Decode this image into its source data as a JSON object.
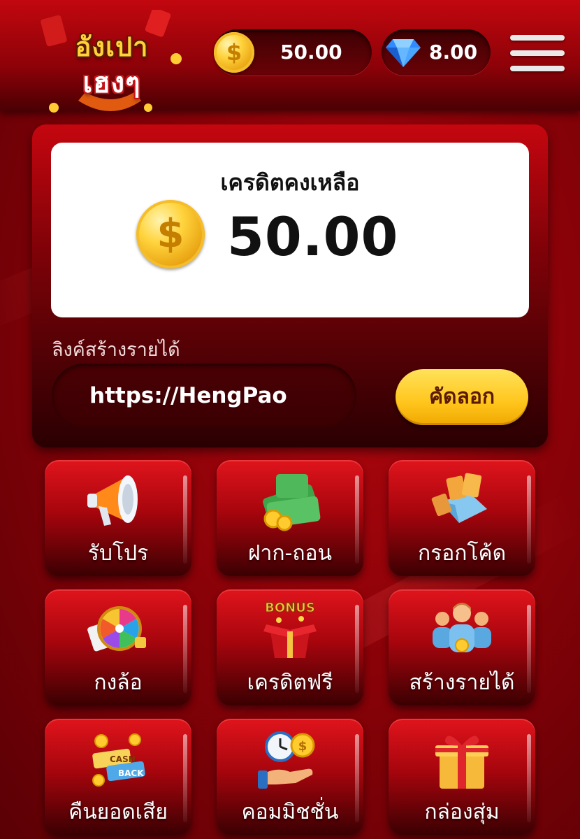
{
  "header": {
    "logo_line1": "อังเปา",
    "logo_line2": "เฮงๆ",
    "coin_balance": "50.00",
    "gem_balance": "8.00",
    "coin_symbol": "$"
  },
  "balance_panel": {
    "title": "เครดิตคงเหลือ",
    "amount": "50.00",
    "coin_symbol": "$",
    "link_label": "ลิงค์สร้างรายได้",
    "link_value": "https://HengPao",
    "copy_label": "คัดลอก"
  },
  "menu_tiles": [
    {
      "label": "รับโปร",
      "icon": "megaphone-icon"
    },
    {
      "label": "ฝาก-ถอน",
      "icon": "money-stack-icon"
    },
    {
      "label": "กรอกโค้ด",
      "icon": "coupon-envelope-icon"
    },
    {
      "label": "กงล้อ",
      "icon": "prize-wheel-icon"
    },
    {
      "label": "เครดิตฟรี",
      "icon": "bonus-box-icon"
    },
    {
      "label": "สร้างรายได้",
      "icon": "team-users-icon"
    },
    {
      "label": "คืนยอดเสีย",
      "icon": "cashback-icon"
    },
    {
      "label": "คอมมิชชั่น",
      "icon": "commission-hand-icon"
    },
    {
      "label": "กล่องสุ่ม",
      "icon": "gift-box-icon"
    }
  ],
  "colors": {
    "brand_red": "#b3070e",
    "dark_red": "#3a0003",
    "gold": "#ffc51c"
  }
}
